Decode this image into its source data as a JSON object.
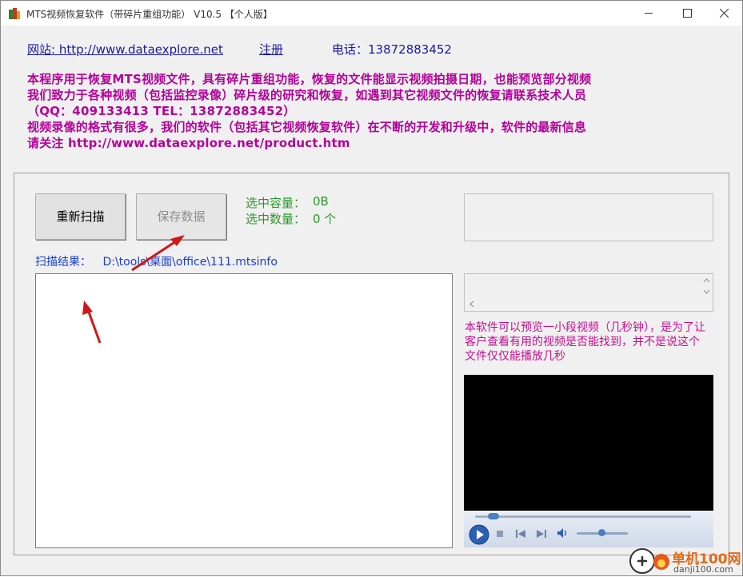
{
  "window": {
    "title": "MTS视频恢复软件（带碎片重组功能） V10.5 【个人版】",
    "minimize_label": "—",
    "maximize_label": "☐",
    "close_label": "✕"
  },
  "header": {
    "site_label": "网站: http://www.dataexplore.net",
    "register_label": "注册",
    "phone_label": "电话：13872883452"
  },
  "description": {
    "line1": "本程序用于恢复MTS视频文件，具有碎片重组功能，恢复的文件能显示视频拍摄日期，也能预览部分视频",
    "line2": "我们致力于各种视频（包括监控录像）碎片级的研究和恢复，如遇到其它视频文件的恢复请联系技术人员",
    "line3": "（QQ：409133413  TEL：13872883452）",
    "line4": "视频录像的格式有很多，我们的软件（包括其它视频恢复软件）在不断的开发和升级中，软件的最新信息",
    "line5": "请关注 http://www.dataexplore.net/product.htm"
  },
  "toolbar": {
    "rescan_label": "重新扫描",
    "save_label": "保存数据"
  },
  "stats": {
    "capacity_label": "选中容量：",
    "capacity_value": "0B",
    "count_label": "选中数量：",
    "count_value": "0 个"
  },
  "scan": {
    "result_label": "扫描结果：",
    "result_path": "D:\\tools\\桌面\\office\\111.mtsinfo"
  },
  "preview": {
    "note": "本软件可以预览一小段视频（几秒钟），是为了让客户查看有用的视频是否能找到，并不是说这个文件仅仅能播放几秒"
  },
  "watermark": {
    "text": "单机100网",
    "url": "danji100.com"
  },
  "colors": {
    "accent_text": "#b3009a",
    "link": "#1a1aa6",
    "stat_green": "#2a9a2a",
    "arrow_red": "#d01818"
  }
}
